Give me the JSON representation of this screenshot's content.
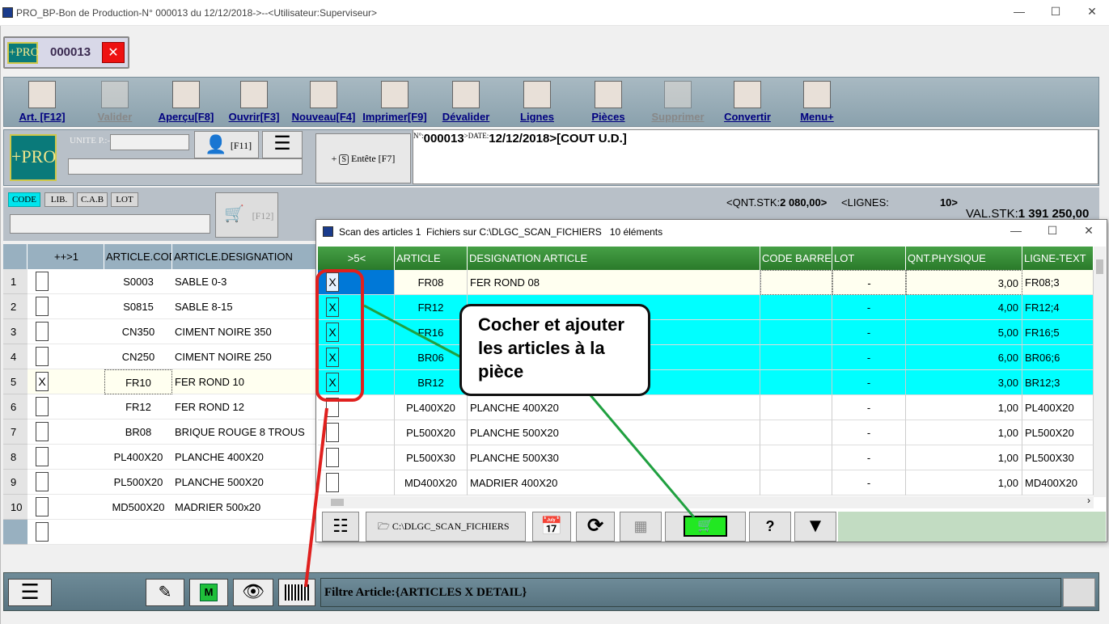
{
  "window": {
    "title": "PRO_BP-Bon de Production-N° 000013 du 12/12/2018->--<Utilisateur:Superviseur>"
  },
  "doc_pill": {
    "logo": "+PRO",
    "number": "000013",
    "close": "✕"
  },
  "toolbar": [
    {
      "label": "Art. [F12]",
      "icon": "grid-icon",
      "enabled": true
    },
    {
      "label": "Valider",
      "icon": "check-icon",
      "enabled": false
    },
    {
      "label": "Aperçu[F8]",
      "icon": "magnifier-icon",
      "enabled": true
    },
    {
      "label": "Ouvrir[F3]",
      "icon": "open-icon",
      "enabled": true
    },
    {
      "label": "Nouveau[F4]",
      "icon": "new-icon",
      "enabled": true
    },
    {
      "label": "Imprimer[F9]",
      "icon": "printer-icon",
      "enabled": true
    },
    {
      "label": "Dévalider",
      "icon": "unvalidate-icon",
      "enabled": true
    },
    {
      "label": "Lignes",
      "icon": "search-icon",
      "enabled": true
    },
    {
      "label": "Pièces",
      "icon": "pieces-icon",
      "enabled": true
    },
    {
      "label": "Supprimer",
      "icon": "delete-icon",
      "enabled": false
    },
    {
      "label": "Convertir",
      "icon": "convert-icon",
      "enabled": true
    },
    {
      "label": "Menu+",
      "icon": "menu-icon",
      "enabled": true
    }
  ],
  "header": {
    "logo": "+PRO",
    "unite_label": "UNITE P.:-",
    "f11": "[F11]",
    "entete": "Entête [F7]",
    "info_prefix_no": "N°:",
    "info_no": "000013",
    "info_prefix_date": ">DATE:",
    "info_date": "12/12/2018",
    "info_rest": ">[COUT U.D.]"
  },
  "filter": {
    "tabs": [
      "CODE",
      "LIB.",
      "C.A.B",
      "LOT"
    ],
    "f12": "[F12]",
    "qnt_label": "<QNT.STK:",
    "qnt_value": "2 080,00>",
    "lignes_label": "<LIGNES:",
    "lignes_value": "10>",
    "val_label": "VAL.STK:",
    "val_value": "1 391 250,00"
  },
  "main_grid": {
    "headers": [
      "++>1",
      "ARTICLE.CODE",
      "ARTICLE.DESIGNATION"
    ],
    "rows": [
      {
        "n": "1",
        "checked": "",
        "code": "S0003",
        "des": "SABLE 0-3"
      },
      {
        "n": "2",
        "checked": "",
        "code": "S0815",
        "des": "SABLE 8-15"
      },
      {
        "n": "3",
        "checked": "",
        "code": "CN350",
        "des": "CIMENT NOIRE 350"
      },
      {
        "n": "4",
        "checked": "",
        "code": "CN250",
        "des": "CIMENT NOIRE 250"
      },
      {
        "n": "5",
        "checked": "X",
        "code": "FR10",
        "des": "FER ROND 10"
      },
      {
        "n": "6",
        "checked": "",
        "code": "FR12",
        "des": "FER ROND 12"
      },
      {
        "n": "7",
        "checked": "",
        "code": "BR08",
        "des": "BRIQUE ROUGE 8 TROUS"
      },
      {
        "n": "8",
        "checked": "",
        "code": "PL400X20",
        "des": "PLANCHE 400X20"
      },
      {
        "n": "9",
        "checked": "",
        "code": "PL500X20",
        "des": "PLANCHE 500X20"
      },
      {
        "n": "10",
        "checked": "",
        "code": "MD500X20",
        "des": "MADRIER 500x20"
      }
    ]
  },
  "bottom": {
    "filter_text": "Filtre Article:{ARTICLES X DETAIL}"
  },
  "dialog": {
    "title": "Scan des articles 1  Fichiers sur C:\\DLGC_SCAN_FICHIERS   10 éléments",
    "headers": [
      ">5<",
      "ARTICLE",
      "DESIGNATION ARTICLE",
      "CODE BARRE",
      "LOT",
      "QNT.PHYSIQUE",
      "LIGNE-TEXT"
    ],
    "rows": [
      {
        "chk": "X",
        "art": "FR08",
        "des": "FER ROND 08",
        "lot": "-",
        "qnt": "3,00",
        "lt": "FR08;3"
      },
      {
        "chk": "X",
        "art": "FR12",
        "des": "",
        "lot": "-",
        "qnt": "4,00",
        "lt": "FR12;4"
      },
      {
        "chk": "X",
        "art": "FR16",
        "des": "",
        "lot": "-",
        "qnt": "5,00",
        "lt": "FR16;5"
      },
      {
        "chk": "X",
        "art": "BR06",
        "des": "",
        "lot": "-",
        "qnt": "6,00",
        "lt": "BR06;6"
      },
      {
        "chk": "X",
        "art": "BR12",
        "des": "",
        "lot": "-",
        "qnt": "3,00",
        "lt": "BR12;3"
      },
      {
        "chk": "",
        "art": "PL400X20",
        "des": "PLANCHE 400X20",
        "lot": "-",
        "qnt": "1,00",
        "lt": "PL400X20"
      },
      {
        "chk": "",
        "art": "PL500X20",
        "des": "PLANCHE 500X20",
        "lot": "-",
        "qnt": "1,00",
        "lt": "PL500X20"
      },
      {
        "chk": "",
        "art": "PL500X30",
        "des": "PLANCHE 500X30",
        "lot": "-",
        "qnt": "1,00",
        "lt": "PL500X30"
      },
      {
        "chk": "",
        "art": "MD400X20",
        "des": "MADRIER 400X20",
        "lot": "-",
        "qnt": "1,00",
        "lt": "MD400X20"
      }
    ],
    "footer_path": "C:\\DLGC_SCAN_FICHIERS",
    "help": "?"
  },
  "callout": {
    "text": "Cocher et ajouter les articles à la pièce"
  },
  "colors": {
    "cyan_row": "#00ffff",
    "header_green": "#2e8b2e",
    "selected_blue": "#0078d7",
    "highlight_red": "#e0201e",
    "arrow_green": "#20a040"
  }
}
